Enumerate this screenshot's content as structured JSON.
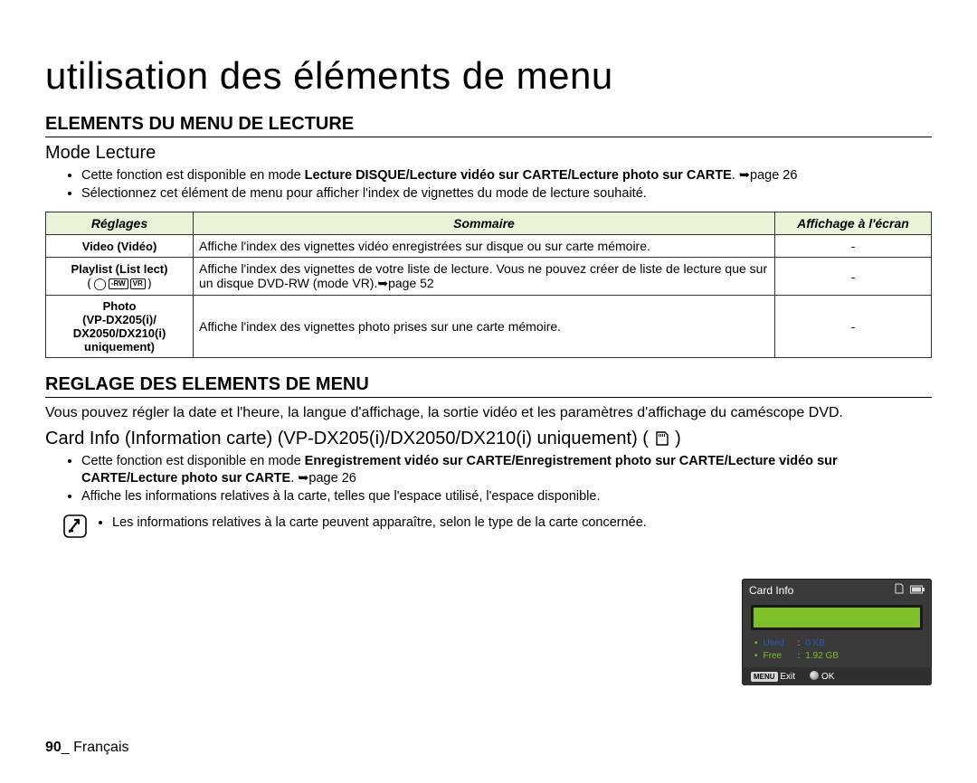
{
  "page": {
    "title": "utilisation des éléments de menu",
    "h2a": "ELEMENTS DU MENU DE LECTURE",
    "h3a": "Mode Lecture",
    "bulletsA": {
      "b1_pre": "Cette fonction est disponible en mode ",
      "b1_bold": "Lecture DISQUE/Lecture vidéo sur CARTE/Lecture photo sur CARTE",
      "b1_post": ". ➥page 26",
      "b2": "Sélectionnez cet élément de menu pour afficher l'index de vignettes du mode de lecture souhaité."
    },
    "table": {
      "th1": "Réglages",
      "th2": "Sommaire",
      "th3": "Affichage à l'écran",
      "rows": [
        {
          "c1": "Video (Vidéo)",
          "c2": "Affiche l'index des vignettes vidéo enregistrées sur disque ou sur carte mémoire.",
          "c3": "-"
        },
        {
          "c1": "Playlist (List lect)",
          "c2": "Affiche l'index des vignettes de votre liste de lecture. Vous ne pouvez créer de liste de lecture que sur un disque DVD-RW (mode VR).➥page 52",
          "c3": "-"
        },
        {
          "c1": "Photo\n(VP-DX205(i)/\nDX2050/DX210(i)\nuniquement)",
          "c2": "Affiche l'index des vignettes photo prises sur une carte mémoire.",
          "c3": "-"
        }
      ]
    },
    "h2b": "REGLAGE DES ELEMENTS DE MENU",
    "paraB": "Vous pouvez régler la date et l'heure, la langue d'affichage, la sortie vidéo et les paramètres d'affichage du caméscope DVD.",
    "h3b": "Card Info (Information carte) (VP-DX205(i)/DX2050/DX210(i) uniquement) (",
    "h3b_close": ")",
    "bulletsB": {
      "b1_pre": "Cette fonction est disponible en mode ",
      "b1_bold": "Enregistrement vidéo sur CARTE/Enregistrement photo sur CARTE/Lecture vidéo sur CARTE/Lecture photo sur CARTE",
      "b1_post": ". ➥page 26",
      "b2": "Affiche les informations relatives à la carte, telles que l'espace utilisé, l'espace disponible."
    },
    "note": "Les informations relatives à la carte peuvent apparaître, selon le type de la carte concernée.",
    "footer_page": "90",
    "footer_sep": "_",
    "footer_lang": " Français"
  },
  "cardinfo": {
    "title": "Card Info",
    "used_label": "Used",
    "used_val": "0 KB",
    "free_label": "Free",
    "free_val": "1.92 GB",
    "menu_btn": "MENU",
    "exit": "Exit",
    "ok": "OK"
  }
}
